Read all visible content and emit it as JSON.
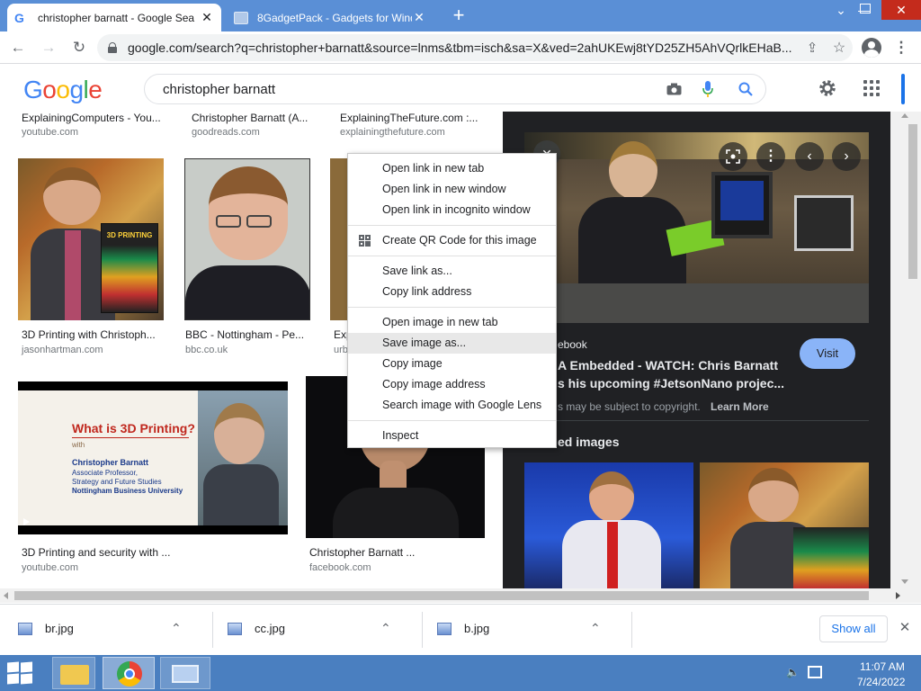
{
  "browser": {
    "tabs": [
      {
        "title": "christopher barnatt - Google Sea",
        "icon": "google-g-icon"
      },
      {
        "title": "8GadgetPack - Gadgets for Wind",
        "icon": "gadget-icon"
      }
    ],
    "url": "google.com/search?q=christopher+barnatt&source=lnms&tbm=isch&sa=X&ved=2ahUKEwj8tYD25ZH5AhVQrlkEHaB..."
  },
  "google": {
    "logo": "Google",
    "query": "christopher barnatt"
  },
  "results": {
    "row0": [
      {
        "caption": "ExplainingComputers - You...",
        "source": "youtube.com"
      },
      {
        "caption": "Christopher Barnatt (A...",
        "source": "goodreads.com"
      },
      {
        "caption": "ExplainingTheFuture.com :...",
        "source": "explainingthefuture.com"
      }
    ],
    "row1": [
      {
        "caption": "3D Printing with Christoph...",
        "source": "jasonhartman.com"
      },
      {
        "caption": "BBC - Nottingham - Pe...",
        "source": "bbc.co.uk"
      },
      {
        "caption": "Exp",
        "source": "urb"
      }
    ],
    "row2": [
      {
        "caption": "3D Printing and security with ...",
        "source": "youtube.com"
      },
      {
        "caption": "Christopher Barnatt ...",
        "source": "facebook.com"
      }
    ],
    "book_title": "3D PRINTING",
    "thumb_text": {
      "title": "What is 3D Printing?",
      "with": "with",
      "name": "Christopher Barnatt",
      "l1": "Associate Professor,",
      "l2": "Strategy and Future Studies",
      "l3": "Nottingham Business University"
    }
  },
  "panel": {
    "source": "ebook",
    "title_l1": "A Embedded - WATCH: Chris Barnatt",
    "title_l2": "s his upcoming #JetsonNano projec...",
    "visit": "Visit",
    "copyright": "s may be subject to copyright.",
    "learn_more": "Learn More",
    "related": "ed images"
  },
  "context_menu": {
    "groups": [
      [
        "Open link in new tab",
        "Open link in new window",
        "Open link in incognito window"
      ],
      [
        "Create QR Code for this image"
      ],
      [
        "Save link as...",
        "Copy link address"
      ],
      [
        "Open image in new tab",
        "Save image as...",
        "Copy image",
        "Copy image address",
        "Search image with Google Lens"
      ],
      [
        "Inspect"
      ]
    ],
    "highlighted": "Save image as..."
  },
  "downloads": {
    "items": [
      "br.jpg",
      "cc.jpg",
      "b.jpg"
    ],
    "show_all": "Show all"
  },
  "taskbar": {
    "time": "11:07 AM",
    "date": "7/24/2022"
  },
  "colors": {
    "tabstrip": "#5a8fd6",
    "panel": "#202124",
    "visit_button": "#8ab4f8",
    "taskbar": "#4a7fc0"
  }
}
